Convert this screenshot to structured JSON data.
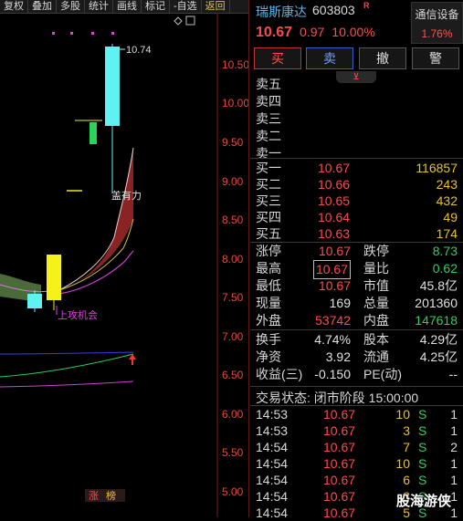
{
  "toolbar": {
    "items": [
      "复权",
      "叠加",
      "多股",
      "统计",
      "画线",
      "标记",
      "-自选",
      "返回"
    ]
  },
  "chart": {
    "price_ticks": [
      "10.50",
      "10.00",
      "9.50",
      "9.00",
      "8.50",
      "8.00",
      "7.50",
      "7.00",
      "6.50",
      "6.00",
      "5.50",
      "5.00"
    ],
    "high_label": "10.74",
    "annotations": {
      "gaiyouli": "盖有力",
      "shanggong": "上攻机会",
      "zhang": "涨",
      "bang": "榜"
    }
  },
  "stock": {
    "name": "瑞斯康达",
    "code": "603803",
    "badge": "R",
    "price": "10.67",
    "change": "0.97",
    "change_pct": "10.00%",
    "device_label": "通信设备",
    "device_pct": "1.76%"
  },
  "buttons": {
    "buy": "买",
    "sell": "卖",
    "cancel": "撤",
    "alert": "警"
  },
  "asks": [
    "卖五",
    "卖四",
    "卖三",
    "卖二",
    "卖一"
  ],
  "bids": [
    {
      "label": "买一",
      "price": "10.67",
      "vol": "116857"
    },
    {
      "label": "买二",
      "price": "10.66",
      "vol": "243"
    },
    {
      "label": "买三",
      "price": "10.65",
      "vol": "432"
    },
    {
      "label": "买四",
      "price": "10.64",
      "vol": "49"
    },
    {
      "label": "买五",
      "price": "10.63",
      "vol": "174"
    }
  ],
  "stats": {
    "zhangting_l": "涨停",
    "zhangting_v": "10.67",
    "dieting_l": "跌停",
    "dieting_v": "8.73",
    "zuigao_l": "最高",
    "zuigao_v": "10.67",
    "liangbi_l": "量比",
    "liangbi_v": "0.62",
    "zuidi_l": "最低",
    "zuidi_v": "10.67",
    "shizhi_l": "市值",
    "shizhi_v": "45.8亿",
    "xianliang_l": "现量",
    "xianliang_v": "169",
    "zongliang_l": "总量",
    "zongliang_v": "201360",
    "waipan_l": "外盘",
    "waipan_v": "53742",
    "neipan_l": "内盘",
    "neipan_v": "147618",
    "huanshou_l": "换手",
    "huanshou_v": "4.74%",
    "guben_l": "股本",
    "guben_v": "4.29亿",
    "jingzi_l": "净资",
    "jingzi_v": "3.92",
    "liutong_l": "流通",
    "liutong_v": "4.25亿",
    "shouyi_l": "收益(三)",
    "shouyi_v": "-0.150",
    "pe_l": "PE(动)",
    "pe_v": "--"
  },
  "trade_status": "交易状态: 闭市阶段 15:00:00",
  "ticks": [
    {
      "t": "14:53",
      "p": "10.67",
      "v": "10",
      "s": "S",
      "n": "1"
    },
    {
      "t": "14:53",
      "p": "10.67",
      "v": "3",
      "s": "S",
      "n": "1"
    },
    {
      "t": "14:54",
      "p": "10.67",
      "v": "7",
      "s": "S",
      "n": "2"
    },
    {
      "t": "14:54",
      "p": "10.67",
      "v": "10",
      "s": "S",
      "n": "1"
    },
    {
      "t": "14:54",
      "p": "10.67",
      "v": "6",
      "s": "S",
      "n": "1"
    },
    {
      "t": "14:54",
      "p": "10.67",
      "v": "3",
      "s": "S",
      "n": "1"
    },
    {
      "t": "14:54",
      "p": "10.67",
      "v": "5",
      "s": "S",
      "n": "1"
    }
  ],
  "watermark": "股海游侠",
  "colors": {
    "up": "#ff4a4a",
    "down": "#2ed15a",
    "vol": "#e8c030",
    "axis": "#e04a3a",
    "cyan": "#5ff2f2"
  }
}
